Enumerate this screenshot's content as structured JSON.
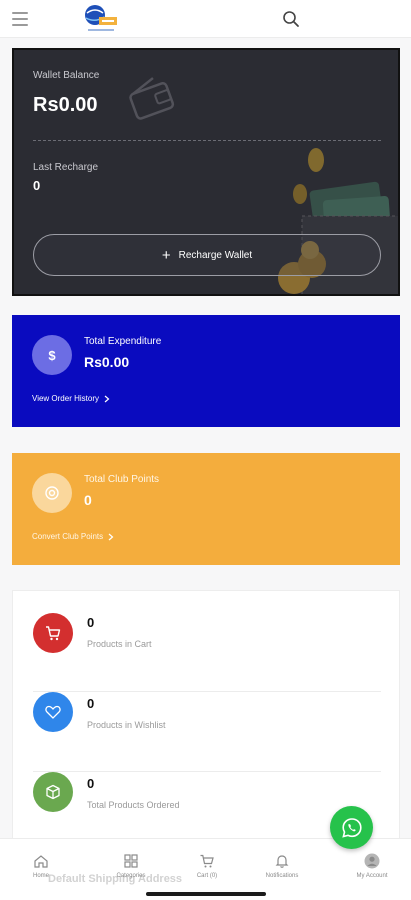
{
  "colors": {
    "wallet_bg": "#2b2c33",
    "expenditure_bg": "#0a0bbf",
    "club_points_bg": "#f4ad3d",
    "cart_icon_bg": "#d32f2f",
    "wishlist_icon_bg": "#2f86ea",
    "ordered_icon_bg": "#6aa84f",
    "whatsapp": "#26c24b"
  },
  "header": {
    "menu_icon": "hamburger-icon",
    "logo": "app-logo",
    "search_icon": "search-icon"
  },
  "wallet": {
    "balance_label": "Wallet Balance",
    "balance_value": "Rs0.00",
    "last_recharge_label": "Last Recharge",
    "last_recharge_value": "0",
    "recharge_button": "Recharge Wallet"
  },
  "expenditure": {
    "icon": "dollar-icon",
    "title": "Total Expenditure",
    "value": "Rs0.00",
    "link": "View Order History"
  },
  "club_points": {
    "icon": "points-icon",
    "title": "Total Club Points",
    "value": "0",
    "link": "Convert Club Points"
  },
  "summary": [
    {
      "icon": "cart-icon",
      "count": "0",
      "label": "Products in Cart"
    },
    {
      "icon": "heart-icon",
      "count": "0",
      "label": "Products in Wishlist"
    },
    {
      "icon": "box-icon",
      "count": "0",
      "label": "Total Products Ordered"
    }
  ],
  "faded_text": "Default Shipping Address",
  "bottom_nav": [
    {
      "icon": "home-icon",
      "label": "Home"
    },
    {
      "icon": "categories-icon",
      "label": "Categories"
    },
    {
      "icon": "cart-icon",
      "label": "Cart (0)"
    },
    {
      "icon": "bell-icon",
      "label": "Notifications"
    },
    {
      "icon": "user-icon",
      "label": "My Account"
    }
  ]
}
